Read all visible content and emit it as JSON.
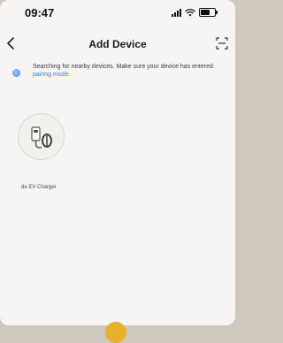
{
  "status_bar": {
    "time": "09:47"
  },
  "header": {
    "title": "Add Device"
  },
  "search": {
    "message": "Searching for nearby devices. Make sure your device has entered ",
    "link_text": "pairing mode",
    "suffix": "."
  },
  "devices": [
    {
      "label": "de EV Charger"
    }
  ],
  "colors": {
    "accent": "#3b7fd9",
    "badge": "#e8b12b"
  }
}
